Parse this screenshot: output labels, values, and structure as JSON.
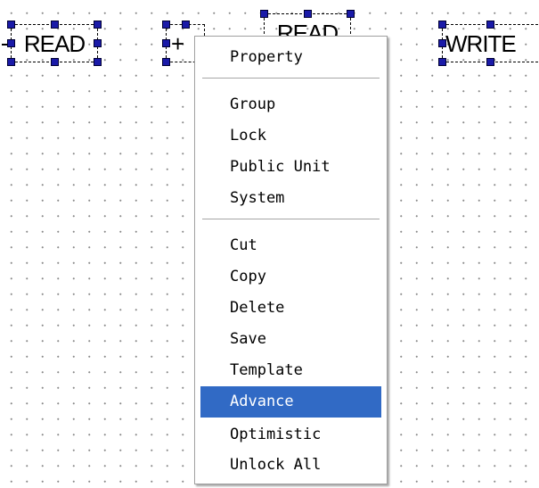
{
  "canvas_objects": [
    {
      "label": "READ"
    },
    {
      "label": "+"
    },
    {
      "label": "READ"
    },
    {
      "label": "WRITE"
    }
  ],
  "context_menu": {
    "property": "Property",
    "group": "Group",
    "lock": "Lock",
    "public_unit": "Public Unit",
    "system": "System",
    "cut": "Cut",
    "copy": "Copy",
    "delete": "Delete",
    "save": "Save",
    "template": "Template",
    "advance": "Advance",
    "optimistic": "Optimistic",
    "unlock_all": "Unlock All",
    "highlighted_item": "Advance",
    "highlight_color": "#316ac5"
  }
}
